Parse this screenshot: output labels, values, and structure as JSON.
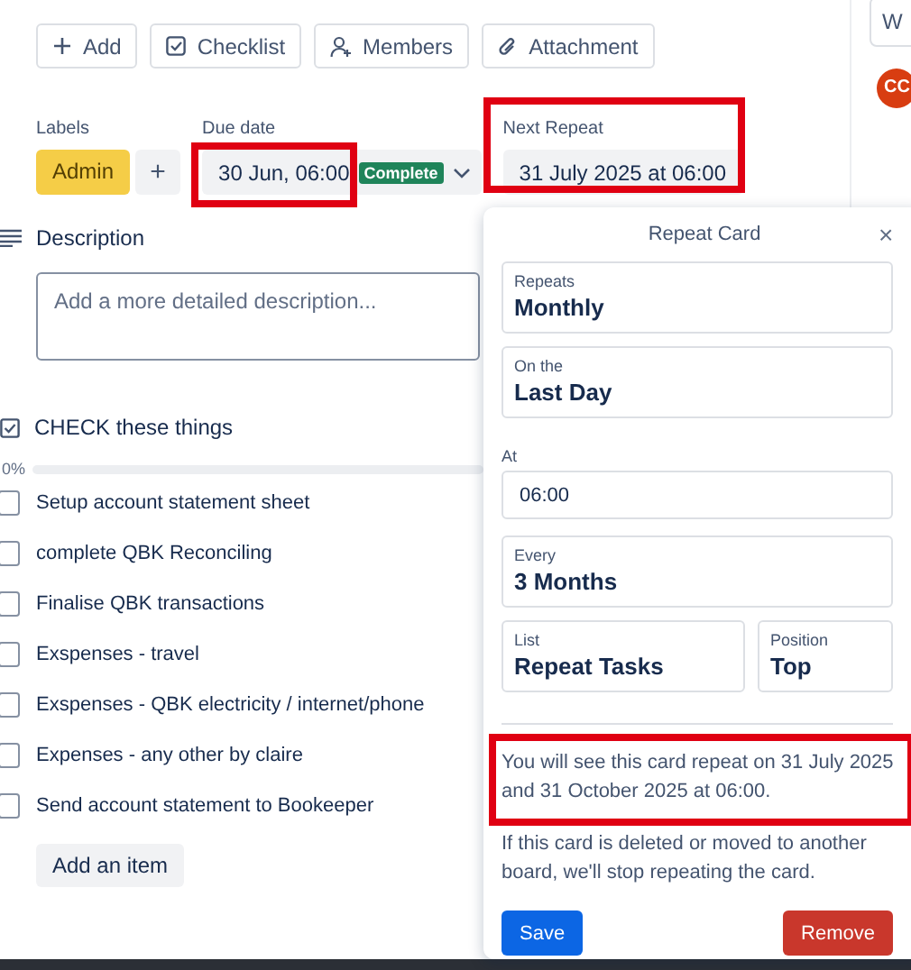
{
  "toolbar": [
    {
      "label": "Add"
    },
    {
      "label": "Checklist"
    },
    {
      "label": "Members"
    },
    {
      "label": "Attachment"
    }
  ],
  "labels": {
    "heading": "Labels",
    "items": [
      {
        "text": "Admin",
        "color": "#f5cd47"
      }
    ],
    "add": "+"
  },
  "due_date": {
    "heading": "Due date",
    "value": "30 Jun, 06:00",
    "badge": "Complete",
    "highlighted": true
  },
  "next_repeat": {
    "heading": "Next Repeat",
    "value": "31 July 2025 at 06:00",
    "highlighted": true
  },
  "description": {
    "heading": "Description",
    "placeholder": "Add a more detailed description..."
  },
  "checklist": {
    "title": "CHECK these things",
    "progress": "0%",
    "level": 0,
    "add_button": "Add an item",
    "items": [
      {
        "text": "Setup account statement sheet",
        "checked": false
      },
      {
        "text": "complete QBK Reconciling",
        "checked": false
      },
      {
        "text": "Finalise QBK transactions",
        "checked": false
      },
      {
        "text": "Exspenses - travel",
        "checked": false
      },
      {
        "text": "Exspenses - QBK electricity / internet/phone",
        "checked": false
      },
      {
        "text": "Expenses - any other by claire",
        "checked": false
      },
      {
        "text": "Send account statement to Bookeeper",
        "checked": false
      }
    ]
  },
  "sidebar": {
    "button": "W",
    "avatar": "CC"
  },
  "repeat_popup": {
    "title": "Repeat Card",
    "close": "×",
    "fields": [
      {
        "kind": "select",
        "label": "Repeats",
        "value": "Monthly"
      },
      {
        "kind": "select",
        "label": "On the",
        "value": "Last Day"
      },
      {
        "kind": "time",
        "label": "At",
        "value": "06:00"
      },
      {
        "kind": "select",
        "label": "Every",
        "value": "3 Months"
      }
    ],
    "row": [
      {
        "label": "List",
        "value": "Repeat Tasks"
      },
      {
        "label": "Position",
        "value": "Top"
      }
    ],
    "notice": {
      "text": "You will see this card repeat on 31 July 2025 and 31 October 2025 at 06:00.",
      "highlighted": true
    },
    "info": "If this card is deleted or moved to another board, we'll stop repeating the card.",
    "save": "Save",
    "remove": "Remove"
  }
}
